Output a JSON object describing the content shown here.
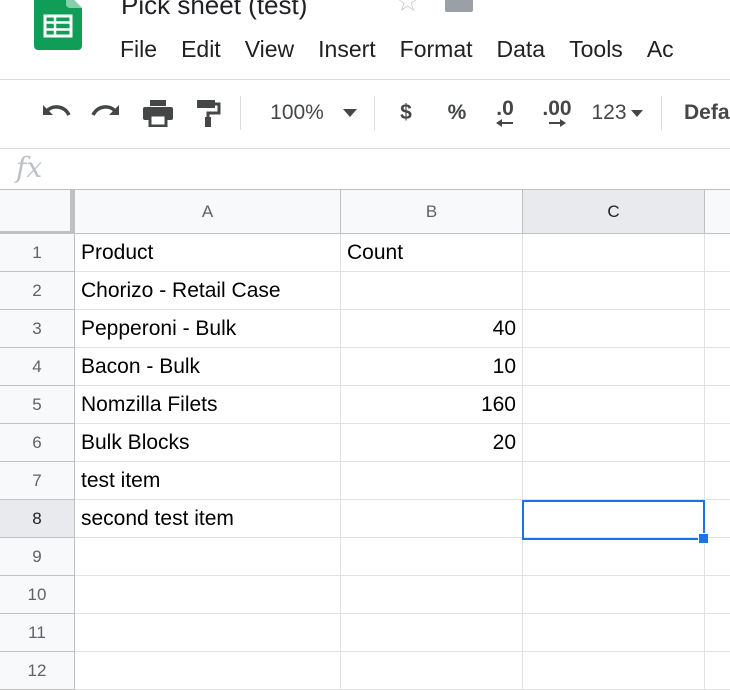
{
  "header": {
    "title": "Pick sheet (test)",
    "logo_icon": "google-sheets-logo",
    "star_icon": "star-outline-icon",
    "folder_icon": "folder-icon",
    "menu": [
      "File",
      "Edit",
      "View",
      "Insert",
      "Format",
      "Data",
      "Tools",
      "Ac"
    ]
  },
  "toolbar": {
    "undo_icon": "undo-icon",
    "redo_icon": "redo-icon",
    "print_icon": "print-icon",
    "paint_format_icon": "paint-format-icon",
    "zoom": "100%",
    "currency": "$",
    "percent": "%",
    "decimal_decrease": ".0",
    "decimal_increase": ".00",
    "more_formats": "123",
    "font": "Defa"
  },
  "formula_bar": {
    "fx_label": "fx",
    "value": ""
  },
  "columns": [
    "A",
    "B",
    "C"
  ],
  "selected_column": "C",
  "selected_row": "8",
  "selected_cell": "C8",
  "rows": [
    {
      "num": "1",
      "a": "Product",
      "b": "Count",
      "b_numeric": false
    },
    {
      "num": "2",
      "a": "Chorizo - Retail Case",
      "b": ""
    },
    {
      "num": "3",
      "a": "Pepperoni - Bulk",
      "b": "40",
      "b_numeric": true
    },
    {
      "num": "4",
      "a": "Bacon - Bulk",
      "b": "10",
      "b_numeric": true
    },
    {
      "num": "5",
      "a": "Nomzilla Filets",
      "b": "160",
      "b_numeric": true
    },
    {
      "num": "6",
      "a": "Bulk Blocks",
      "b": "20",
      "b_numeric": true
    },
    {
      "num": "7",
      "a": "test item",
      "b": ""
    },
    {
      "num": "8",
      "a": "second test item",
      "b": ""
    },
    {
      "num": "9",
      "a": "",
      "b": ""
    },
    {
      "num": "10",
      "a": "",
      "b": ""
    },
    {
      "num": "11",
      "a": "",
      "b": ""
    },
    {
      "num": "12",
      "a": "",
      "b": ""
    }
  ],
  "colors": {
    "selection": "#1a73e8",
    "header_bg": "#f8f9fa",
    "selected_header_bg": "#e8eaed",
    "logo_green": "#0f9d58"
  }
}
